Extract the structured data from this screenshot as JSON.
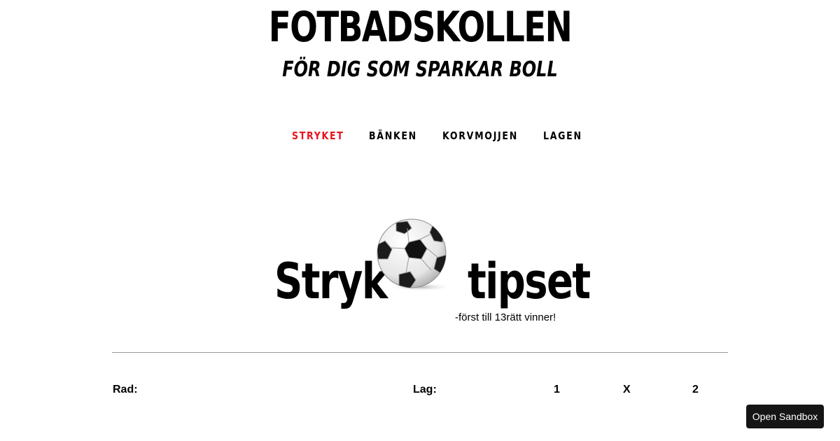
{
  "header": {
    "site_title": "FOTBADSKOLLEN",
    "tagline": "FÖR DIG SOM SPARKAR BOLL"
  },
  "nav": {
    "items": [
      {
        "label": "STRYKET",
        "active": true
      },
      {
        "label": "BÄNKEN",
        "active": false
      },
      {
        "label": "KORVMOJJEN",
        "active": false
      },
      {
        "label": "LAGEN",
        "active": false
      }
    ]
  },
  "logo": {
    "word_left": "Stryk",
    "word_right": "tipset",
    "subtitle": "-först till 13rätt vinner!",
    "icon": "soccer-ball-icon"
  },
  "table": {
    "headers": {
      "row": "Rad:",
      "team": "Lag:",
      "home": "1",
      "draw": "X",
      "away": "2"
    }
  },
  "sandbox_button": {
    "label": "Open Sandbox"
  },
  "colors": {
    "accent": "#e8131b",
    "text": "#000000",
    "button_bg": "#151515"
  }
}
